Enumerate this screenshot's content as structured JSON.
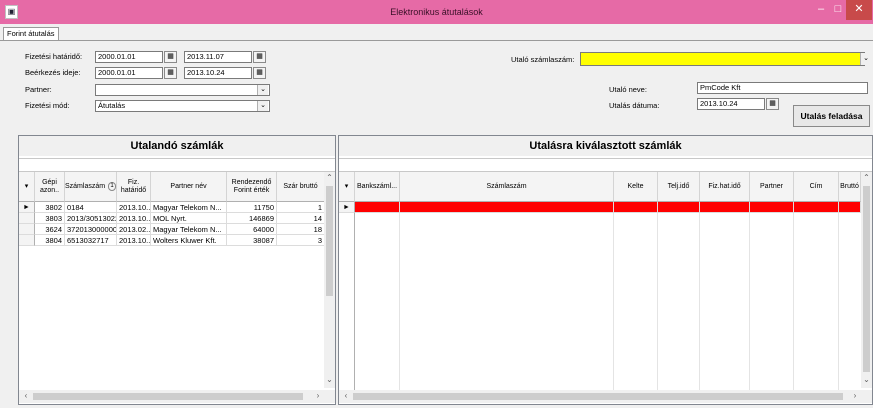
{
  "window": {
    "title": "Elektronikus átutalások",
    "title_color": "#e66aa6"
  },
  "tabs": [
    {
      "label": "Forint átutalás"
    }
  ],
  "filters": {
    "fizetesi_hatarido_label": "Fizetési határidő:",
    "fizetesi_hatarido_from": "2000.01.01",
    "fizetesi_hatarido_to": "2013.11.07",
    "beerkezes_ideje_label": "Beérkezés ideje:",
    "beerkezes_ideje_from": "2000.01.01",
    "beerkezes_ideje_to": "2013.10.24",
    "partner_label": "Partner:",
    "partner_value": "",
    "fizetesi_mod_label": "Fizetési mód:",
    "fizetesi_mod_value": "Átutalás"
  },
  "transfer": {
    "utalo_szamlaszam_label": "Utaló számlaszám:",
    "utalo_szamlaszam_value": "",
    "utalo_neve_label": "Utaló neve:",
    "utalo_neve_value": "PmCode Kft",
    "utalas_datuma_label": "Utalás dátuma:",
    "utalas_datuma_value": "2013.10.24",
    "submit_label": "Utalás feladása",
    "highlight_color": "#ffff00"
  },
  "left_grid": {
    "title": "Utalandó számlák",
    "columns": [
      "Gépi azon..",
      "Számlaszám",
      "Fiz. határidő",
      "Partner név",
      "Rendezendő Forint érték",
      "Szár bruttó"
    ],
    "sort_indicator": "1",
    "rows": [
      {
        "gepi": "3802",
        "szamlaszam": "0184",
        "hatarido": "2013.10...",
        "partner": "Magyar Telekom N...",
        "ertek": "11750",
        "brutto": "1"
      },
      {
        "gepi": "3803",
        "szamlaszam": "2013/305130227...",
        "hatarido": "2013.10...",
        "partner": "MOL Nyrt.",
        "ertek": "146869",
        "brutto": "14"
      },
      {
        "gepi": "3624",
        "szamlaszam": "37201300000005...",
        "hatarido": "2013.02...",
        "partner": "Magyar Telekom N...",
        "ertek": "64000",
        "brutto": "18"
      },
      {
        "gepi": "3804",
        "szamlaszam": "6513032717",
        "hatarido": "2013.10...",
        "partner": "Wolters Kluwer Kft.",
        "ertek": "38087",
        "brutto": "3"
      }
    ]
  },
  "right_grid": {
    "title": "Utalásra kiválasztott számlák",
    "columns": [
      "Bankszáml...",
      "Számlaszám",
      "Kelte",
      "Telj.idő",
      "Fiz.hat.idő",
      "Partner",
      "Cím",
      "Bruttó"
    ],
    "new_row_color": "#ff0000"
  },
  "icons": {
    "app": "app-icon",
    "calendar": "calendar-icon",
    "dropdown": "chevron-down-icon",
    "current_row": "row-pointer-icon",
    "filter": "filter-dropdown-icon"
  }
}
